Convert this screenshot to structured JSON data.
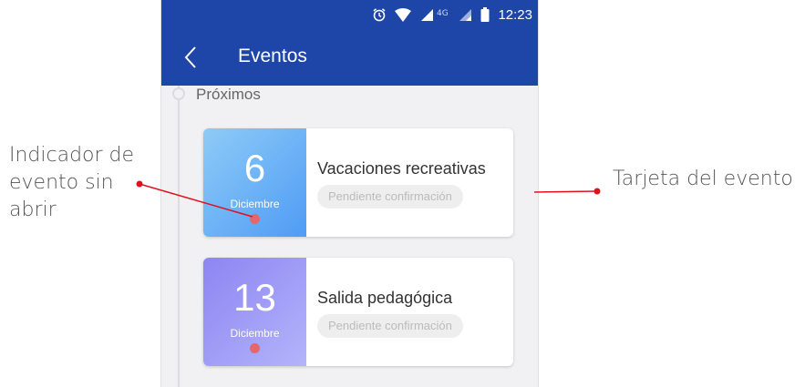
{
  "annotations": {
    "unread_indicator": "Indicador de evento sin abrir",
    "event_card": "Tarjeta del evento",
    "line_color": "#e0101f"
  },
  "status_bar": {
    "network": "4G",
    "time": "12:23",
    "icons": [
      "alarm-icon",
      "wifi-icon",
      "signal-icon",
      "signal-icon",
      "battery-icon"
    ]
  },
  "app_bar": {
    "title": "Eventos",
    "back_icon": "back-arrow-icon",
    "color": "#1e45a8"
  },
  "section": {
    "title": "Próximos"
  },
  "events": [
    {
      "day": "6",
      "month": "Diciembre",
      "title": "Vacaciones recreativas",
      "status": "Pendiente confirmación",
      "unread": true
    },
    {
      "day": "13",
      "month": "Diciembre",
      "title": "Salida pedagógica",
      "status": "Pendiente confirmación",
      "unread": true
    }
  ]
}
